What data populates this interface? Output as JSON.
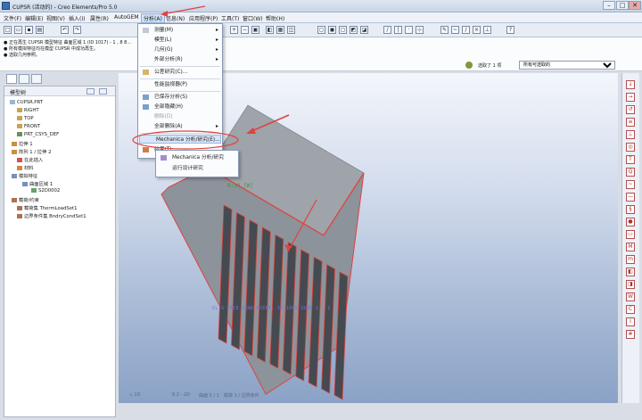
{
  "window": {
    "title": "CUPSR (活动的) - Creo Elements/Pro 5.0",
    "min": "–",
    "max": "□",
    "close": "✕"
  },
  "menubar": [
    "文件(F)",
    "编辑(E)",
    "视图(V)",
    "插入(I)",
    "属性(R)",
    "AutoGEM",
    "分析(A)",
    "信息(N)",
    "应用程序(P)",
    "工具(T)",
    "窗口(W)",
    "帮助(H)"
  ],
  "messages": [
    "● 正在再生 CUPSR 模型特征  曲面区域 1 (ID 1017) - 1 , 8 8...",
    "● 所有模拟特征均在模型 CUPSR 中成功再生。",
    "● 选取几何参照。"
  ],
  "filter": {
    "selected": "选取了 1 项",
    "option": "所有可选取的"
  },
  "tree": {
    "title": "模型树",
    "items": [
      "CUPSR.PRT",
      "RIGHT",
      "TOP",
      "FRONT",
      "PRT_CSYS_DEF",
      "拉伸 1",
      "阵列 1 / 拉伸 2",
      "在此插入",
      "材料",
      "模拟特征",
      "曲面区域 1",
      "S2D0002",
      "载荷/约束",
      "载荷集 ThermLoadSet1",
      "边界条件集 BndryCondSet1"
    ]
  },
  "menu": {
    "items": [
      {
        "label": "测量(M)",
        "sub": true
      },
      {
        "label": "模型(L)",
        "sub": true
      },
      {
        "label": "几何(G)",
        "sub": true
      },
      {
        "label": "外部分析(R)",
        "sub": true
      },
      {
        "label": "公差研究(C)...",
        "sub": false
      },
      {
        "label": "性能监视器(P)",
        "sub": false
      },
      {
        "label": "已保存分析(S)",
        "sub": false
      },
      {
        "label": "全部隐藏(H)",
        "sub": false
      },
      {
        "label": "删除(D)",
        "sub": false
      },
      {
        "label": "全部删除(A)",
        "sub": true
      },
      {
        "label": "Mechanica 分析/研究(E)...",
        "sub": false
      },
      {
        "label": "结果(T)",
        "sub": false
      }
    ],
    "arrow": "▸"
  },
  "submenu": {
    "items": [
      "Mechanica 分析/研究",
      "运行设计研究"
    ]
  },
  "viewport": {
    "label_center": "8:50 [W]",
    "label_bottom": "CL-S FACE LOAD POINT: ID 1005 SURF 1 - 1"
  },
  "status": {
    "s1": "◇  1D",
    "s2": "8.2 - 2D",
    "s3": "曲面 5 / 1",
    "s4": "载荷 1 / 边界条件"
  },
  "colors": {
    "accent": "#e0423f",
    "body": "#a4a9ae",
    "face": "#9aa4ae"
  },
  "icons": [
    "new-file-icon",
    "open-icon",
    "save-icon",
    "print-icon",
    "undo-icon",
    "redo-icon",
    "zoom-in-icon",
    "zoom-out-icon",
    "refit-icon",
    "datum-plane-icon",
    "datum-axis-icon",
    "datum-point-icon",
    "csys-icon",
    "help-icon"
  ]
}
